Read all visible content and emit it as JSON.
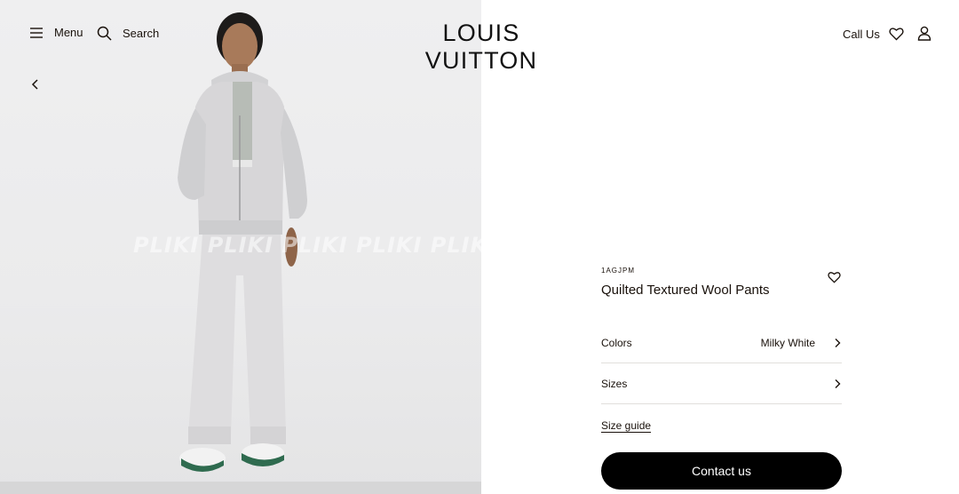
{
  "header": {
    "menu_label": "Menu",
    "search_label": "Search",
    "logo_text": "LOUIS VUITTON",
    "call_us_label": "Call Us"
  },
  "gallery": {
    "watermark_text": "PLIKI PLIKI PLIKI PLIKI PLIKI"
  },
  "product": {
    "sku": "1AGJPM",
    "name": "Quilted Textured Wool Pants",
    "colors_label": "Colors",
    "color_value": "Milky White",
    "sizes_label": "Sizes",
    "size_guide_label": "Size guide",
    "contact_label": "Contact us"
  },
  "icons": {
    "menu": "hamburger-icon",
    "search": "search-icon",
    "wishlist": "heart-icon",
    "account": "user-icon",
    "back": "chevron-left-icon",
    "row_arrow": "chevron-right-icon"
  },
  "colors": {
    "text": "#19110b",
    "button_bg": "#000000",
    "button_text": "#ffffff",
    "divider": "#e1dfdc",
    "gallery_bg": "#ececed"
  }
}
